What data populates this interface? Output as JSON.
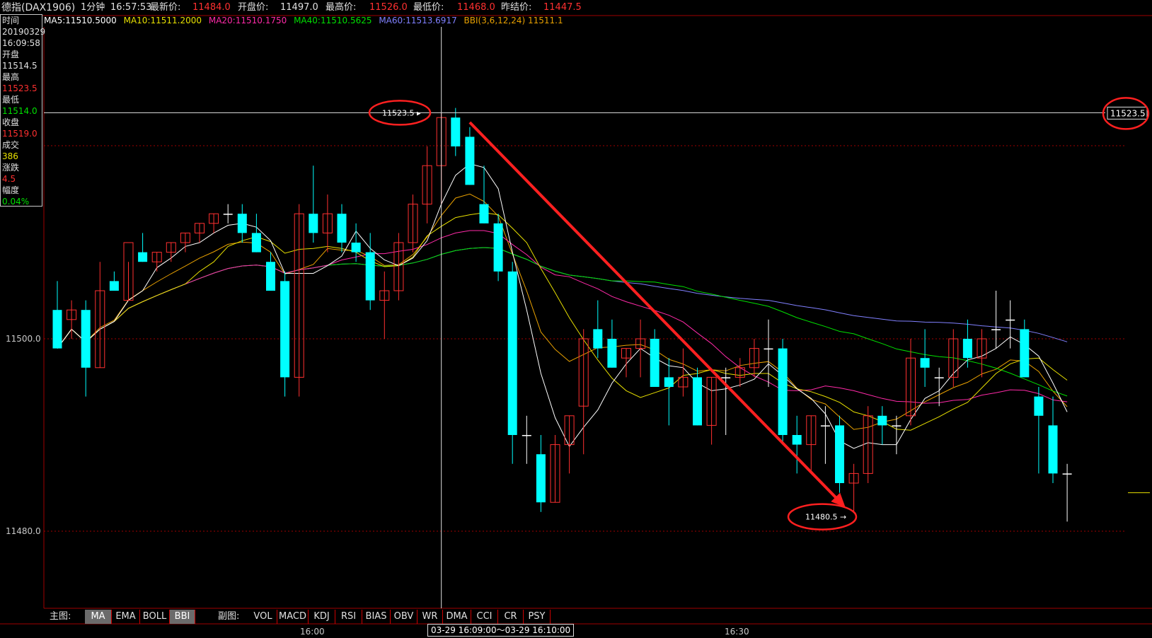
{
  "header": {
    "symbol": "德指(DAX1906)",
    "period": "1分钟",
    "time": "16:57:53",
    "last_label": "最新价:",
    "last_value": "11484.0",
    "open_label": "开盘价:",
    "open_value": "11497.0",
    "high_label": "最高价:",
    "high_value": "11526.0",
    "low_label": "最低价:",
    "low_value": "11468.0",
    "prev_label": "昨结价:",
    "prev_value": "11447.5"
  },
  "ma_bar": {
    "ma5": "MA5:11510.5000",
    "ma10": "MA10:11511.2000",
    "ma20": "MA20:11510.1750",
    "ma40": "MA40:11510.5625",
    "ma60": "MA60:11513.6917",
    "bbi": "BBI(3,6,12,24)  11511.1"
  },
  "infobox": {
    "time_label": "时间",
    "date": "20190329",
    "time": "16:09:58",
    "open_label": "开盘",
    "open": "11514.5",
    "high_label": "最高",
    "high": "11523.5",
    "low_label": "最低",
    "low": "11514.0",
    "close_label": "收盘",
    "close": "11519.0",
    "volume_label": "成交",
    "volume": "386",
    "change_label": "涨跌",
    "change": "4.5",
    "pct_label": "幅度",
    "pct": "0.04%"
  },
  "price_axis": {
    "p1": "11500.0",
    "p2": "11480.0"
  },
  "crosshair": {
    "left_value": "11523.5",
    "right_value": "11523.5"
  },
  "annotation": {
    "low_value": "11480.5"
  },
  "main_tabs": {
    "label": "主图:",
    "items": [
      "MA",
      "EMA",
      "BOLL",
      "BBI"
    ],
    "active": [
      "MA",
      "BBI"
    ]
  },
  "sub_tabs": {
    "label": "副图:",
    "items": [
      "VOL",
      "MACD",
      "KDJ",
      "RSI",
      "BIAS",
      "OBV",
      "WR",
      "DMA",
      "CCI",
      "CR",
      "PSY"
    ]
  },
  "time_axis": {
    "t1": "16:00",
    "t2": "16:30",
    "selection": "03-29  16:09:00〜03-29  16:10:00"
  },
  "colors": {
    "bull": "#ff3030",
    "bear": "#00ffff",
    "ma5": "#ffffff",
    "ma10": "#e8e000",
    "ma20": "#ff2aa8",
    "ma40": "#00e000",
    "ma60": "#8080ff",
    "bbi": "#e8a000",
    "arrow": "#ff2020"
  },
  "chart_data": {
    "type": "candlestick",
    "interval": "1分钟",
    "yticks": [
      11500.0,
      11480.0
    ],
    "candles": [
      {
        "o": 11503,
        "h": 11506,
        "l": 11499,
        "c": 11499
      },
      {
        "o": 11502,
        "h": 11504,
        "l": 11500,
        "c": 11503
      },
      {
        "o": 11503,
        "h": 11504,
        "l": 11494,
        "c": 11497
      },
      {
        "o": 11497,
        "h": 11508,
        "l": 11497,
        "c": 11505
      },
      {
        "o": 11506,
        "h": 11507,
        "l": 11505,
        "c": 11505
      },
      {
        "o": 11504,
        "h": 11508,
        "l": 11504,
        "c": 11510
      },
      {
        "o": 11509,
        "h": 11511,
        "l": 11508,
        "c": 11508
      },
      {
        "o": 11508,
        "h": 11509,
        "l": 11507,
        "c": 11509
      },
      {
        "o": 11509,
        "h": 11510,
        "l": 11508,
        "c": 11510
      },
      {
        "o": 11510,
        "h": 11511,
        "l": 11509,
        "c": 11511
      },
      {
        "o": 11511,
        "h": 11512,
        "l": 11510,
        "c": 11512
      },
      {
        "o": 11512,
        "h": 11513,
        "l": 11511,
        "c": 11513
      },
      {
        "o": 11513,
        "h": 11514,
        "l": 11512,
        "c": 11513
      },
      {
        "o": 11513,
        "h": 11514,
        "l": 11510,
        "c": 11511
      },
      {
        "o": 11511,
        "h": 11513,
        "l": 11509,
        "c": 11509
      },
      {
        "o": 11508,
        "h": 11509,
        "l": 11505,
        "c": 11505
      },
      {
        "o": 11506,
        "h": 11507,
        "l": 11494,
        "c": 11496
      },
      {
        "o": 11496,
        "h": 11514,
        "l": 11494,
        "c": 11513
      },
      {
        "o": 11513,
        "h": 11518,
        "l": 11510,
        "c": 11511
      },
      {
        "o": 11511,
        "h": 11515,
        "l": 11509,
        "c": 11513
      },
      {
        "o": 11513,
        "h": 11514,
        "l": 11509,
        "c": 11510
      },
      {
        "o": 11510,
        "h": 11512,
        "l": 11508,
        "c": 11509
      },
      {
        "o": 11509,
        "h": 11511,
        "l": 11503,
        "c": 11504
      },
      {
        "o": 11504,
        "h": 11507,
        "l": 11500,
        "c": 11505
      },
      {
        "o": 11505,
        "h": 11511,
        "l": 11504,
        "c": 11510
      },
      {
        "o": 11510,
        "h": 11515,
        "l": 11509,
        "c": 11514
      },
      {
        "o": 11514,
        "h": 11520,
        "l": 11512,
        "c": 11518
      },
      {
        "o": 11518,
        "h": 11523.5,
        "l": 11514,
        "c": 11523
      },
      {
        "o": 11523,
        "h": 11524,
        "l": 11519,
        "c": 11520
      },
      {
        "o": 11521,
        "h": 11522,
        "l": 11516,
        "c": 11516
      },
      {
        "o": 11514,
        "h": 11518,
        "l": 11512,
        "c": 11512
      },
      {
        "o": 11512,
        "h": 11513,
        "l": 11506,
        "c": 11507
      },
      {
        "o": 11507,
        "h": 11508,
        "l": 11487,
        "c": 11490
      },
      {
        "o": 11490,
        "h": 11492,
        "l": 11487,
        "c": 11490
      },
      {
        "o": 11488,
        "h": 11490,
        "l": 11482,
        "c": 11483
      },
      {
        "o": 11483,
        "h": 11490,
        "l": 11483,
        "c": 11489
      },
      {
        "o": 11489,
        "h": 11492,
        "l": 11486,
        "c": 11492
      },
      {
        "o": 11493,
        "h": 11501,
        "l": 11488,
        "c": 11500
      },
      {
        "o": 11501,
        "h": 11504,
        "l": 11498,
        "c": 11499
      },
      {
        "o": 11500,
        "h": 11502,
        "l": 11497,
        "c": 11497
      },
      {
        "o": 11498,
        "h": 11499,
        "l": 11496,
        "c": 11499
      },
      {
        "o": 11499,
        "h": 11502,
        "l": 11496,
        "c": 11500
      },
      {
        "o": 11500,
        "h": 11501,
        "l": 11495,
        "c": 11495
      },
      {
        "o": 11496,
        "h": 11498,
        "l": 11491,
        "c": 11495
      },
      {
        "o": 11495,
        "h": 11499,
        "l": 11494,
        "c": 11496
      },
      {
        "o": 11496,
        "h": 11497,
        "l": 11491,
        "c": 11491
      },
      {
        "o": 11491,
        "h": 11496,
        "l": 11489,
        "c": 11496
      },
      {
        "o": 11496,
        "h": 11497,
        "l": 11490,
        "c": 11496
      },
      {
        "o": 11496,
        "h": 11498,
        "l": 11495,
        "c": 11497
      },
      {
        "o": 11497,
        "h": 11500,
        "l": 11496,
        "c": 11499
      },
      {
        "o": 11499,
        "h": 11502,
        "l": 11495,
        "c": 11499
      },
      {
        "o": 11499,
        "h": 11500,
        "l": 11489,
        "c": 11490
      },
      {
        "o": 11490,
        "h": 11492,
        "l": 11486,
        "c": 11489
      },
      {
        "o": 11489,
        "h": 11492,
        "l": 11486,
        "c": 11492
      },
      {
        "o": 11491,
        "h": 11493,
        "l": 11487,
        "c": 11491
      },
      {
        "o": 11491,
        "h": 11492,
        "l": 11484,
        "c": 11485
      },
      {
        "o": 11485,
        "h": 11487,
        "l": 11482,
        "c": 11486
      },
      {
        "o": 11486,
        "h": 11493,
        "l": 11485,
        "c": 11492
      },
      {
        "o": 11492,
        "h": 11493,
        "l": 11489,
        "c": 11491
      },
      {
        "o": 11491,
        "h": 11492,
        "l": 11488,
        "c": 11491
      },
      {
        "o": 11492,
        "h": 11500,
        "l": 11491,
        "c": 11498
      },
      {
        "o": 11498,
        "h": 11501,
        "l": 11495,
        "c": 11497
      },
      {
        "o": 11496,
        "h": 11497,
        "l": 11493,
        "c": 11496
      },
      {
        "o": 11496,
        "h": 11501,
        "l": 11495,
        "c": 11500
      },
      {
        "o": 11500,
        "h": 11502,
        "l": 11497,
        "c": 11498
      },
      {
        "o": 11498,
        "h": 11501,
        "l": 11496,
        "c": 11500
      },
      {
        "o": 11501,
        "h": 11505,
        "l": 11499,
        "c": 11501
      },
      {
        "o": 11502,
        "h": 11504,
        "l": 11499,
        "c": 11502
      },
      {
        "o": 11501,
        "h": 11502,
        "l": 11496,
        "c": 11496
      },
      {
        "o": 11494,
        "h": 11495,
        "l": 11486,
        "c": 11492
      },
      {
        "o": 11491,
        "h": 11494,
        "l": 11485,
        "c": 11486
      },
      {
        "o": 11486,
        "h": 11487,
        "l": 11481,
        "c": 11486
      }
    ],
    "annotations": [
      {
        "type": "arrow",
        "from_index": 29,
        "from_price": 11523,
        "to_index": 55,
        "to_price": 11482
      },
      {
        "type": "circle-label",
        "text": "11523.5"
      },
      {
        "type": "circle-label",
        "text": "11480.5"
      }
    ]
  }
}
